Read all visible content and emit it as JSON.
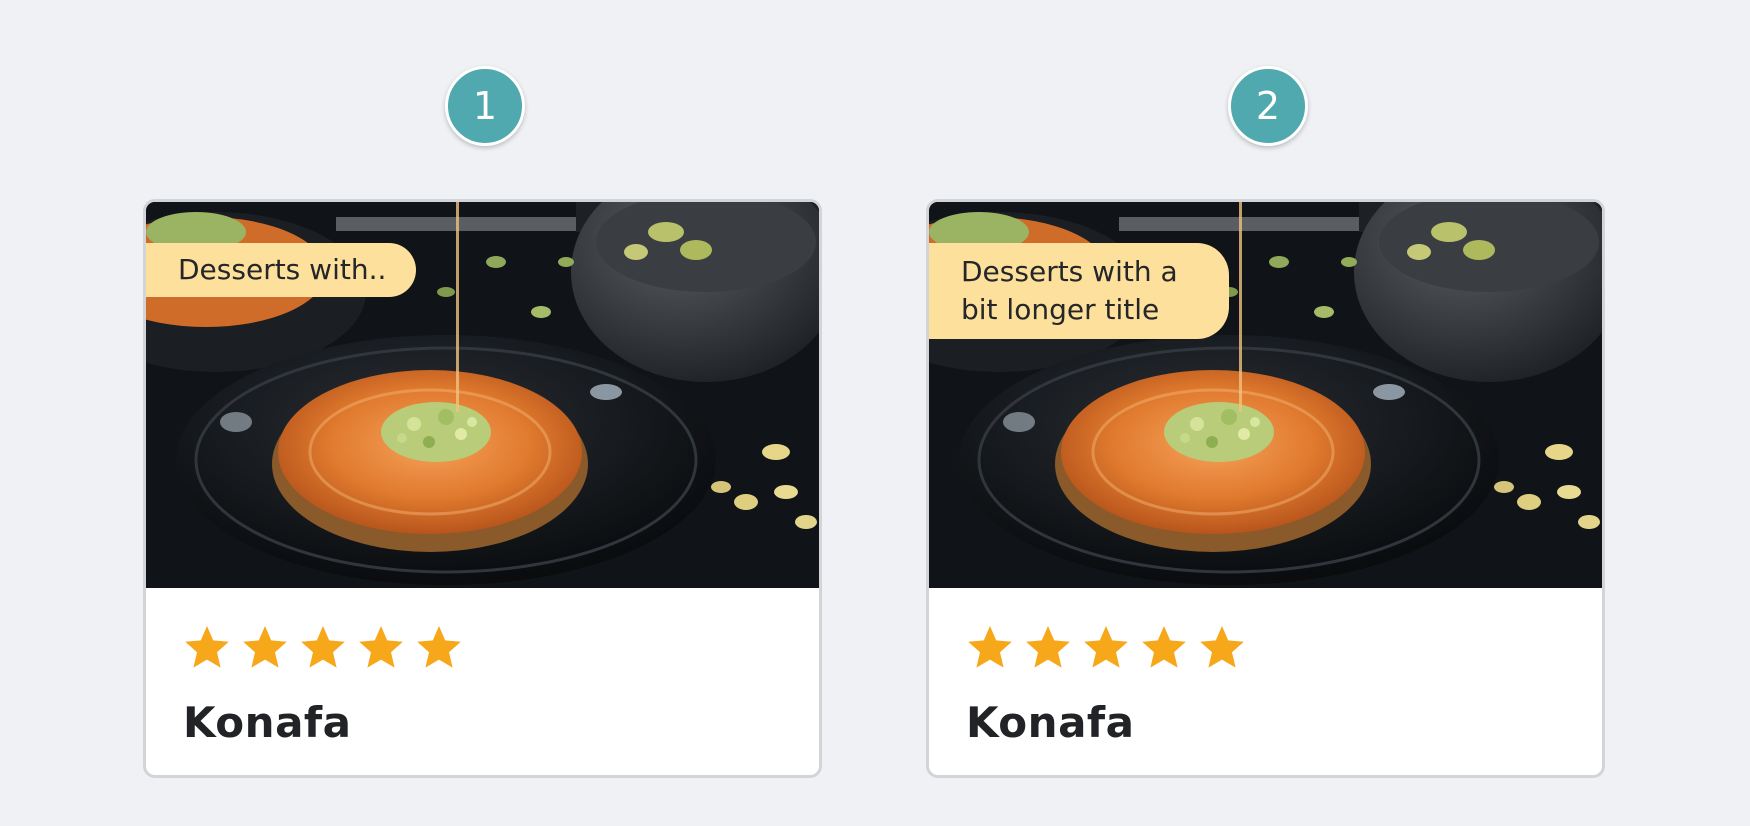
{
  "cards": [
    {
      "number": "1",
      "tag": "Desserts with..",
      "photo": "konafa-photo",
      "rating": 5,
      "stars": [
        "star-icon",
        "star-icon",
        "star-icon",
        "star-icon",
        "star-icon"
      ],
      "title": "Konafa"
    },
    {
      "number": "2",
      "tag": "Desserts with a bit longer title",
      "photo": "konafa-photo",
      "rating": 5,
      "stars": [
        "star-icon",
        "star-icon",
        "star-icon",
        "star-icon",
        "star-icon"
      ],
      "title": "Konafa"
    }
  ],
  "colors": {
    "background": "#eff1f5",
    "badge": "#4fa9ae",
    "tag": "#fde09b",
    "star": "#f6a71a",
    "title": "#222326"
  }
}
